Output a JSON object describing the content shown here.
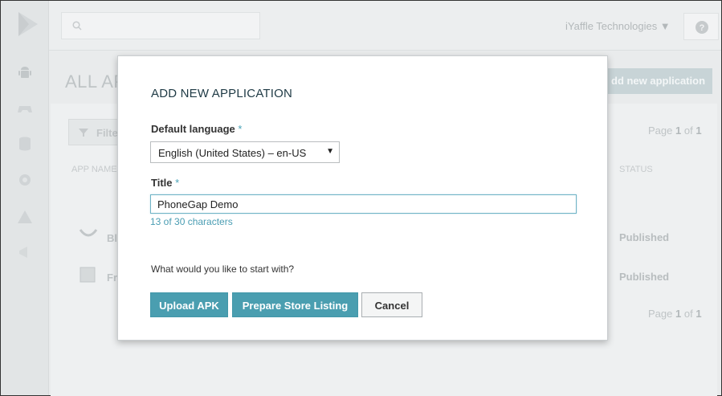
{
  "background": {
    "account_name": "iYaffle Technologies ▼",
    "page_title": "ALL AP",
    "add_button_label": "dd new application",
    "filter_label": "Filte",
    "pager_top": {
      "prefix": "Page",
      "current": "1",
      "sep": "of",
      "total": "1"
    },
    "pager_bottom": {
      "prefix": "Page",
      "current": "1",
      "sep": "of",
      "total": "1"
    },
    "columns": {
      "app_name": "APP NAME",
      "status": "STATUS"
    },
    "rows": [
      {
        "name": "Bl",
        "status": "Published"
      },
      {
        "name": "Fr",
        "status": "Published"
      }
    ]
  },
  "dialog": {
    "title": "ADD NEW APPLICATION",
    "language_label": "Default language",
    "language_required": "*",
    "language_value": "English (United States) – en-US",
    "title_label": "Title",
    "title_required": "*",
    "title_value": "PhoneGap Demo",
    "char_count": "13 of 30 characters",
    "question": "What would you like to start with?",
    "buttons": {
      "upload": "Upload APK",
      "listing": "Prepare Store Listing",
      "cancel": "Cancel"
    }
  },
  "colors": {
    "accent": "#4a9eb0",
    "overlay": "#e9ebec"
  }
}
